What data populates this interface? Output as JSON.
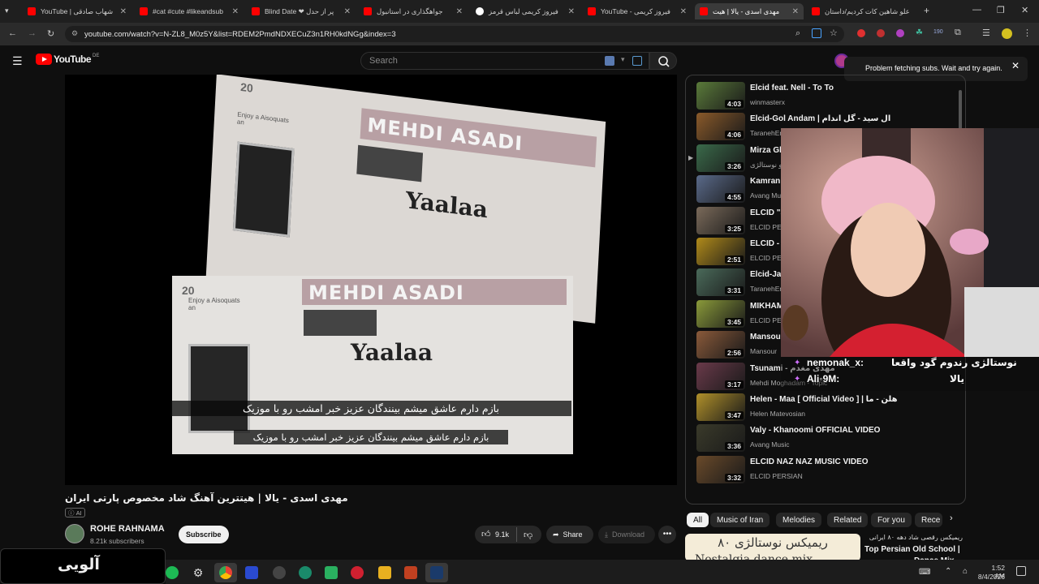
{
  "browser": {
    "tabs": [
      {
        "title": "YouTube | شهاب صادقی",
        "color": "#ff0000"
      },
      {
        "title": "#cat #cute #likeandsub",
        "color": "#ff0000"
      },
      {
        "title": "Blind Date ❤ پر از حدل",
        "color": "#ff0000"
      },
      {
        "title": "جواهگذاری در استانبول",
        "color": "#ff0000"
      },
      {
        "title": "فیروز کریمی لباس قرمز",
        "color": "#ffffff"
      },
      {
        "title": "YouTube - فیروز کریمی",
        "color": "#ff0000"
      },
      {
        "title": "مهدی اسدی - یالا | هیت",
        "color": "#ff0000"
      },
      {
        "title": "علو شاهین کات کردیم/داستان",
        "color": "#ff0000"
      }
    ],
    "url": "youtube.com/watch?v=N-ZL8_M0z5Y&list=RDEM2PmdNDXECuZ3n1RH0kdNGg&index=3"
  },
  "youtube": {
    "logo_text": "YouTube",
    "region": "DE",
    "search_placeholder": "Search",
    "notification": "Problem fetching subs. Wait and try again."
  },
  "video": {
    "paper_header": "MEHDI ASADI",
    "paper_title": "Yaalaa",
    "paper_issue": "20",
    "paper_small": "Enjoy a Aisoquats an",
    "subtitle_line1": "بازم دارم عاشق میشم بینندگان عزیز خبر امشب رو با موزیک",
    "subtitle_line2": "بازم دارم عاشق میشم بینندگان عزیز خبر امشب رو با موزیک",
    "title": "مهدی اسدی - یالا | هیتترین آهنگ شاد مخصوص پارتی ایران",
    "ai_badge": "AI",
    "channel": "ROHE RAHNAMA",
    "subscribers": "8.21k subscribers",
    "subscribe_label": "Subscribe",
    "likes": "9.1k",
    "share_label": "Share",
    "download_label": "Download"
  },
  "playlist": [
    {
      "title": "Elcid feat. Nell - To To",
      "channel": "winmasterx",
      "duration": "4:03",
      "color": "#5a7a3a"
    },
    {
      "title": "Elcid-Gol Andam | ال سید - گل اندام",
      "channel": "TaranehEnergy",
      "duration": "4:06",
      "color": "#8a5a2a"
    },
    {
      "title": "Mirza Ghasemi - بازیگر | نوستالژی دهه ۸۰ ایران",
      "channel": "ویدیو نوستالژی",
      "duration": "3:26",
      "color": "#3a6a4a"
    },
    {
      "title": "Kamran & Hooman - کامران و هومن | VIDEO | Official",
      "channel": "Avang Music",
      "duration": "4:55",
      "color": "#5a6a8a"
    },
    {
      "title": "ELCID \"Seyed\" - Official Video",
      "channel": "ELCID PERSIAN",
      "duration": "3:25",
      "color": "#7a6a5a"
    },
    {
      "title": "ELCID - کلاغ‌ها | Official VIDEO",
      "channel": "ELCID PERSIAN",
      "duration": "2:51",
      "color": "#b08a1a"
    },
    {
      "title": "Elcid-Jan Jan | ال سید - جان",
      "channel": "TaranehEnergy",
      "duration": "3:31",
      "color": "#4a6a5a"
    },
    {
      "title": "MIKHAM | میخام - Official Video",
      "channel": "ELCID PERSIAN",
      "duration": "3:45",
      "color": "#8a9a3a"
    },
    {
      "title": "Mansour - Arezoomeh | منصور",
      "channel": "Mansour",
      "duration": "2:56",
      "color": "#8a5a3a"
    },
    {
      "title": "Tsunami - مهدی مغدم",
      "channel": "Mehdi Moghadam - Topic",
      "duration": "3:17",
      "color": "#6a3a4a"
    },
    {
      "title": "Helen - Maa [ Official Video ] | هلن - ما",
      "channel": "Helen Matevosian",
      "duration": "3:47",
      "color": "#b0902a"
    },
    {
      "title": "Valy - Khanoomi OFFICIAL VIDEO",
      "channel": "Avang Music",
      "duration": "3:36",
      "color": "#3a3a2a"
    },
    {
      "title": "ELCID NAZ NAZ MUSIC VIDEO",
      "channel": "ELCID PERSIAN",
      "duration": "3:32",
      "color": "#6a4a2a"
    }
  ],
  "chips": [
    "All",
    "Music of Iran",
    "Melodies",
    "Related",
    "For you",
    "Rece"
  ],
  "recommendation": {
    "thumb_text": "ریمیکس نوستالژی ۸۰",
    "thumb_sub": "Nostalgia dance mix",
    "title_fa": "ریمیکس رقصی شاد دهه ۸۰ ایرانی",
    "title_en": "Top Persian Old School |",
    "title_en2": "Dance Mix"
  },
  "stream_chat": {
    "line1_user": "nemonak_x:",
    "line1_text": "نوستالژی رندوم گود واقعا",
    "line2_user": "Ali◦9M:",
    "line2_text": "یالا"
  },
  "taskbar": {
    "brand": "آلویی",
    "time": "1:52 AM",
    "date": "8/4/2026"
  }
}
